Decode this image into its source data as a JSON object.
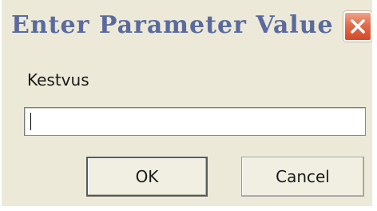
{
  "window": {
    "title": "Enter Parameter Value",
    "close_icon": "close-icon"
  },
  "form": {
    "label": "Kestvus",
    "value": ""
  },
  "buttons": {
    "ok_label": "OK",
    "cancel_label": "Cancel"
  },
  "colors": {
    "dialog_background": "#ece9d8",
    "title_text": "#5a6a9e",
    "close_button": "#e06c4c"
  }
}
